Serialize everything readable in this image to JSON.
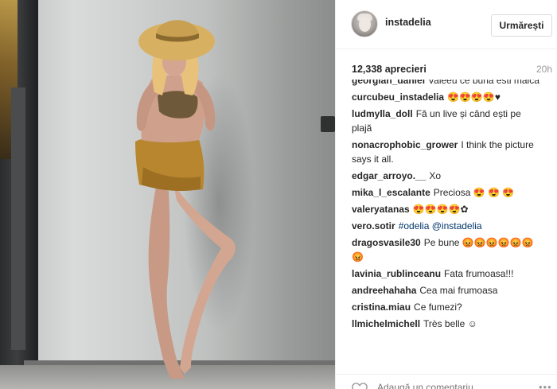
{
  "post": {
    "author": "instadelia",
    "follow_label": "Urmărești",
    "likes": "12,338 aprecieri",
    "time": "20h"
  },
  "comments": [
    {
      "user": "georgian_daniel",
      "text": "Valeeu ce buna esti maica"
    },
    {
      "user": "curcubeu_instadelia",
      "text": "😍😍😍😍♥"
    },
    {
      "user": "ludmylla_doll",
      "text": "Fă un live și când ești pe plajă"
    },
    {
      "user": "nonacrophobic_grower",
      "text": "I think the picture says it all."
    },
    {
      "user": "edgar_arroyo.__",
      "text": "Xo"
    },
    {
      "user": "mika_l_escalante",
      "text": "Preciosa 😍 😍 😍"
    },
    {
      "user": "valeryatanas",
      "text": "😍😍😍😍✿"
    },
    {
      "user": "vero.sotir",
      "text": "#odelia @instadelia"
    },
    {
      "user": "dragosvasile30",
      "text": "Pe bune 😡😡😡😡😡😡😡"
    },
    {
      "user": "lavinia_rublinceanu",
      "text": "Fata frumoasa!!!"
    },
    {
      "user": "andreehahaha",
      "text": "Cea mai frumoasa"
    },
    {
      "user": "cristina.miau",
      "text": "Ce fumezi?"
    },
    {
      "user": "llmichelmichell",
      "text": "Très belle ☺"
    }
  ],
  "add_comment": {
    "placeholder": "Adaugă un comentariu..."
  },
  "icons": {
    "like": "heart-icon",
    "options": "more-options-icon",
    "avatar": "avatar"
  },
  "colors": {
    "link": "#003569",
    "muted": "#999999",
    "text": "#262626",
    "border": "#efefef"
  }
}
